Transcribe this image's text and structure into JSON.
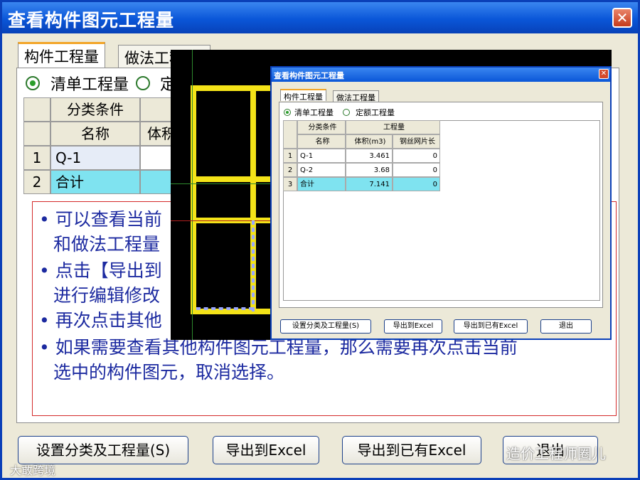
{
  "main_dialog": {
    "title": "查看构件图元工程量",
    "close_glyph": "✕",
    "tabs": [
      {
        "label": "构件工程量",
        "active": true
      },
      {
        "label": "做法工程量",
        "active": false
      }
    ],
    "radios": [
      {
        "label": "清单工程量",
        "selected": true
      },
      {
        "label": "定",
        "selected": false
      }
    ],
    "table": {
      "group_header": "分类条件",
      "name_header": "名称",
      "col2_header": "体积",
      "rows": [
        {
          "num": "1",
          "name": "Q-1"
        },
        {
          "num": "2",
          "name": "合计"
        }
      ]
    },
    "notes": [
      "可以查看当前",
      "和做法工程量",
      "点击【导出到",
      "进行编辑修改",
      "再次点击其他",
      "如果需要查看其他构件图元工程量，那么需要再次点击当前",
      "选中的构件图元，取消选择。"
    ],
    "buttons": {
      "set_category": "设置分类及工程量(S)",
      "export_excel": "导出到Excel",
      "export_existing": "导出到已有Excel",
      "exit": "退出"
    }
  },
  "sub_dialog": {
    "title": "查看构件图元工程量",
    "close_glyph": "✕",
    "tabs": [
      {
        "label": "构件工程量",
        "active": true
      },
      {
        "label": "做法工程量",
        "active": false
      }
    ],
    "radios": [
      {
        "label": "清单工程量",
        "selected": true
      },
      {
        "label": "定额工程量",
        "selected": false
      }
    ],
    "table": {
      "group_header": "分类条件",
      "quantity_header": "工程量",
      "name_header": "名称",
      "volume_header": "体积(m3)",
      "mesh_header": "钢丝网片长",
      "rows": [
        {
          "num": "1",
          "name": "Q-1",
          "volume": "3.461",
          "mesh": "0"
        },
        {
          "num": "2",
          "name": "Q-2",
          "volume": "3.68",
          "mesh": "0"
        },
        {
          "num": "3",
          "name": "合计",
          "volume": "7.141",
          "mesh": "0"
        }
      ]
    },
    "buttons": {
      "set_category": "设置分类及工程量(S)",
      "export_excel": "导出到Excel",
      "export_existing": "导出到已有Excel",
      "exit": "退出"
    }
  },
  "watermarks": {
    "left": "大敢跨境",
    "right": "造价工程师圈儿"
  },
  "colors": {
    "title_blue": "#0a56d8",
    "note_text": "#1c2aa0",
    "total_row": "#7fe3f0",
    "cad_yellow": "#f4e318"
  }
}
